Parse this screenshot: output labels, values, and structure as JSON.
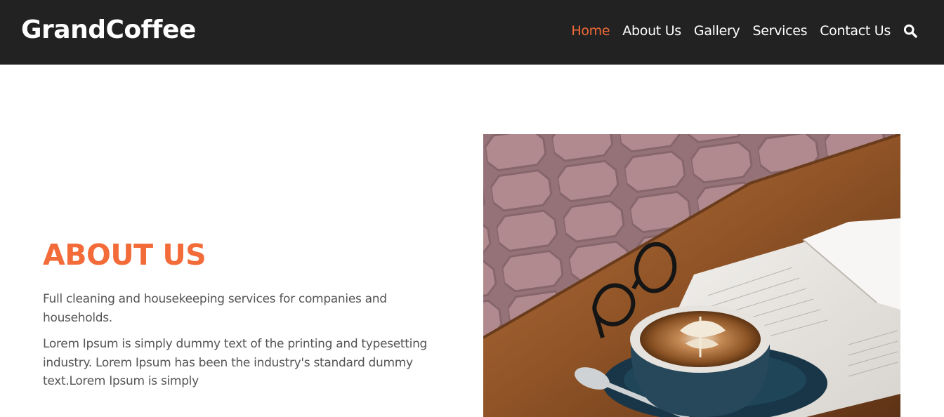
{
  "header": {
    "logo": "GrandCoffee",
    "nav": [
      {
        "label": "Home",
        "active": true
      },
      {
        "label": "About Us",
        "active": false
      },
      {
        "label": "Gallery",
        "active": false
      },
      {
        "label": "Services",
        "active": false
      },
      {
        "label": "Contact Us",
        "active": false
      }
    ],
    "search_icon": "search-icon"
  },
  "about": {
    "title": "ABOUT US",
    "paragraph1": "Full cleaning and housekeeping services for companies and households.",
    "paragraph2": "Lorem Ipsum is simply dummy text of the printing and typesetting industry. Lorem Ipsum has been the industry's standard dummy text.Lorem Ipsum is simply"
  },
  "image": {
    "subject": "coffee-cup-book-glasses"
  },
  "colors": {
    "header_bg": "#222222",
    "accent": "#f26b38",
    "text": "#555555"
  }
}
